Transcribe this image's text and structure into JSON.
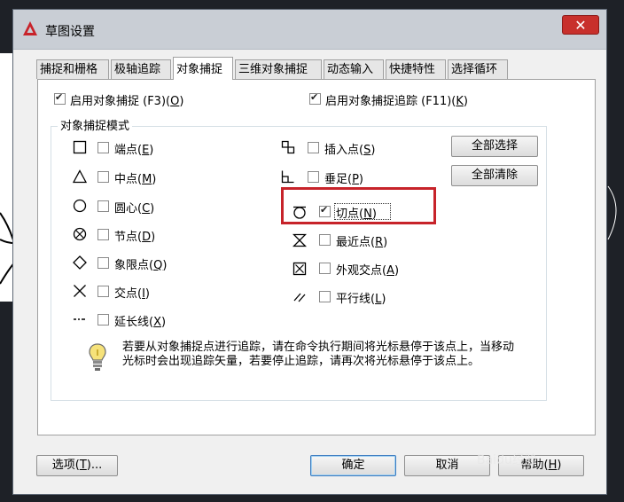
{
  "title": "草图设置",
  "tabs": [
    "捕捉和栅格",
    "极轴追踪",
    "对象捕捉",
    "三维对象捕捉",
    "动态输入",
    "快捷特性",
    "选择循环"
  ],
  "top_checks": {
    "osnap": {
      "label": "启用对象捕捉 (F3)(",
      "key": "O",
      "end": ")",
      "checked": true
    },
    "otrack": {
      "label": "启用对象捕捉追踪 (F11)(",
      "key": "K",
      "end": ")",
      "checked": true
    }
  },
  "group_title": "对象捕捉模式",
  "modes_left": [
    {
      "label": "端点(",
      "key": "E",
      "end": ")",
      "icon": "square-icon",
      "checked": false
    },
    {
      "label": "中点(",
      "key": "M",
      "end": ")",
      "icon": "triangle-icon",
      "checked": false
    },
    {
      "label": "圆心(",
      "key": "C",
      "end": ")",
      "icon": "circle-icon",
      "checked": false
    },
    {
      "label": "节点(",
      "key": "D",
      "end": ")",
      "icon": "node-icon",
      "checked": false
    },
    {
      "label": "象限点(",
      "key": "Q",
      "end": ")",
      "icon": "diamond-icon",
      "checked": false
    },
    {
      "label": "交点(",
      "key": "I",
      "end": ")",
      "icon": "cross-icon",
      "checked": false
    },
    {
      "label": "延长线(",
      "key": "X",
      "end": ")",
      "icon": "extension-icon",
      "checked": false
    }
  ],
  "modes_right": [
    {
      "label": "插入点(",
      "key": "S",
      "end": ")",
      "icon": "insertion-icon",
      "checked": false
    },
    {
      "label": "垂足(",
      "key": "P",
      "end": ")",
      "icon": "perpendicular-icon",
      "checked": false
    },
    {
      "label": "切点(",
      "key": "N",
      "end": ")",
      "icon": "tangent-icon",
      "checked": true
    },
    {
      "label": "最近点(",
      "key": "R",
      "end": ")",
      "icon": "nearest-icon",
      "checked": false
    },
    {
      "label": "外观交点(",
      "key": "A",
      "end": ")",
      "icon": "apparent-intersection-icon",
      "checked": false
    },
    {
      "label": "平行线(",
      "key": "L",
      "end": ")",
      "icon": "parallel-icon",
      "checked": false
    }
  ],
  "buttons": {
    "select_all": "全部选择",
    "clear_all": "全部清除",
    "options": "选项(",
    "options_key": "T",
    "options_end": ")...",
    "ok": "确定",
    "cancel": "取消",
    "help": "帮助(",
    "help_key": "H",
    "help_end": ")"
  },
  "info_text": "若要从对象捕捉点进行追踪，请在命令执行期间将光标悬停于该点上，当移动光标时会出现追踪矢量，若要停止追踪，请再次将光标悬停于该点上。",
  "watermark": "Baidu经验",
  "colors": {
    "highlight": "#c7232a",
    "titlebar": "#c9ced5",
    "close": "#c8302c"
  }
}
